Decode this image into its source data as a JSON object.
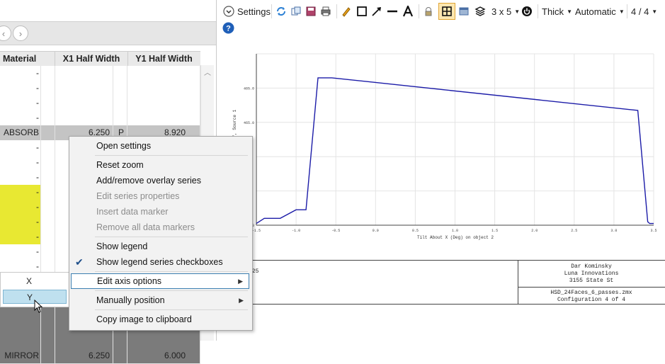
{
  "left_pane": {
    "columns": [
      "Material",
      "X1 Half Width",
      "Y1 Half Width"
    ],
    "rows": [
      {
        "material": "-",
        "x1": "",
        "flag": "",
        "y1": "",
        "style": "white"
      },
      {
        "material": "-",
        "x1": "",
        "flag": "",
        "y1": "",
        "style": "white"
      },
      {
        "material": "-",
        "x1": "",
        "flag": "",
        "y1": "",
        "style": "white"
      },
      {
        "material": "-",
        "x1": "",
        "flag": "",
        "y1": "",
        "style": "white"
      },
      {
        "material": "ABSORB",
        "x1": "6.250",
        "flag": "P",
        "y1": "8.920",
        "style": "gray"
      },
      {
        "material": "-",
        "x1": "",
        "flag": "",
        "y1": "",
        "style": "white"
      },
      {
        "material": "-",
        "x1": "",
        "flag": "",
        "y1": "",
        "style": "white"
      },
      {
        "material": "-",
        "x1": "",
        "flag": "",
        "y1": "",
        "style": "white"
      },
      {
        "material": "-",
        "x1": "",
        "flag": "",
        "y1": "",
        "style": "yellow"
      },
      {
        "material": "-",
        "x1": "",
        "flag": "",
        "y1": "",
        "style": "yellow"
      },
      {
        "material": "-",
        "x1": "",
        "flag": "",
        "y1": "",
        "style": "yellow"
      },
      {
        "material": "-",
        "x1": "",
        "flag": "",
        "y1": "",
        "style": "yellow"
      },
      {
        "material": "-",
        "x1": "",
        "flag": "",
        "y1": "",
        "style": "white"
      },
      {
        "material": "-",
        "x1": "",
        "flag": "",
        "y1": "",
        "style": "white"
      },
      {
        "material": "",
        "x1": "",
        "flag": "",
        "y1": "",
        "style": "white"
      },
      {
        "material": "",
        "x1": "",
        "flag": "",
        "y1": "",
        "style": "white"
      },
      {
        "material": "",
        "x1": "",
        "flag": "",
        "y1": "",
        "style": "dark"
      },
      {
        "material": "",
        "x1": "",
        "flag": "",
        "y1": "",
        "style": "dark"
      },
      {
        "material": "",
        "x1": "",
        "flag": "",
        "y1": "",
        "style": "dark"
      },
      {
        "material": "MIRROR",
        "x1": "6.250",
        "flag": "",
        "y1": "6.000",
        "style": "dark"
      }
    ],
    "axis_list": [
      "X",
      "Y"
    ],
    "colors": {
      "yellow_row": "#e8e832",
      "gray_row": "#c4c4c4",
      "dark_row": "#7b7b7b",
      "selected": "#bfe0ef"
    }
  },
  "toolbar": {
    "settings_label": "Settings",
    "grid_label": "3 x 5",
    "thickness_label": "Thick",
    "scale_label": "Automatic",
    "page_label": "4 / 4",
    "icons": [
      "settings-chevron-icon",
      "refresh-icon",
      "copy-icon",
      "save-icon",
      "print-icon",
      "pencil-icon",
      "rectangle-icon",
      "arrow-line-icon",
      "line-icon",
      "text-icon",
      "lock-icon",
      "layout-icon",
      "window-icon",
      "layers-icon",
      "power-icon",
      "help-icon"
    ]
  },
  "chart": {
    "line_color": "#1c1ca8",
    "y_axis_label": "X, Deg. ... Data 17, Source 1",
    "x_axis_label": "Tilt About X (Deg) on object 2",
    "y_ticks": [
      "0",
      "465.0",
      "465.0"
    ],
    "x_ticks": [
      "-1.5",
      "-1.0",
      "-0.5",
      "0.0",
      "0.5",
      "1.0",
      "1.5",
      "2.0",
      "2.5",
      "3.0",
      "3.5"
    ]
  },
  "chart_data": {
    "type": "line",
    "title": "",
    "xlabel": "Tilt About X (Deg) on object 2",
    "ylabel": "X, Deg. ... Data 17, Source 1",
    "x": [
      0.0,
      0.02,
      0.06,
      0.1,
      0.125,
      0.155,
      0.19,
      0.96,
      0.985,
      0.99,
      1.0
    ],
    "y": [
      0.01,
      0.04,
      0.04,
      0.09,
      0.09,
      0.86,
      0.86,
      0.67,
      0.02,
      0.01,
      0.01
    ],
    "series": [
      {
        "values": [
          0.01,
          0.04,
          0.04,
          0.09,
          0.09,
          0.86,
          0.86,
          0.67,
          0.02,
          0.01,
          0.01
        ]
      }
    ],
    "grid": true,
    "legend": "none"
  },
  "footer": {
    "left_text": "325",
    "right_lines": [
      "Dar Kominsky",
      "Luna Innovations",
      "3155 State St"
    ],
    "file_lines": [
      "HSD_24Faces_6_passes.zmx",
      "Configuration 4 of 4"
    ]
  },
  "context_menu": {
    "items": [
      {
        "label": "Open settings",
        "enabled": true,
        "checked": false,
        "submenu": false
      },
      {
        "sep": true
      },
      {
        "label": "Reset zoom",
        "enabled": true,
        "checked": false,
        "submenu": false
      },
      {
        "label": "Add/remove overlay series",
        "enabled": true,
        "checked": false,
        "submenu": false
      },
      {
        "label": "Edit series properties",
        "enabled": false,
        "checked": false,
        "submenu": false
      },
      {
        "label": "Insert data marker",
        "enabled": false,
        "checked": false,
        "submenu": false
      },
      {
        "label": "Remove all data markers",
        "enabled": false,
        "checked": false,
        "submenu": false
      },
      {
        "sep": true
      },
      {
        "label": "Show legend",
        "enabled": true,
        "checked": false,
        "submenu": false
      },
      {
        "label": "Show legend series checkboxes",
        "enabled": true,
        "checked": true,
        "submenu": false
      },
      {
        "sep": true
      },
      {
        "label": "Edit axis options",
        "enabled": true,
        "checked": false,
        "submenu": true,
        "highlighted": true
      },
      {
        "sep": true
      },
      {
        "label": "Manually position",
        "enabled": true,
        "checked": false,
        "submenu": true
      },
      {
        "sep": true
      },
      {
        "label": "Copy image to clipboard",
        "enabled": true,
        "checked": false,
        "submenu": false
      }
    ]
  }
}
